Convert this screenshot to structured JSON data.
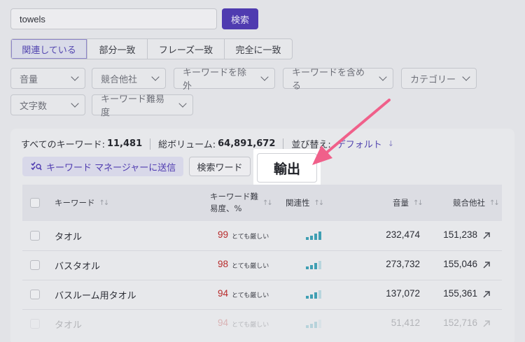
{
  "search": {
    "value": "towels",
    "button_label": "検索"
  },
  "match_tabs": [
    {
      "label": "関連している",
      "active": true
    },
    {
      "label": "部分一致",
      "active": false
    },
    {
      "label": "フレーズ一致",
      "active": false
    },
    {
      "label": "完全に一致",
      "active": false
    }
  ],
  "filters": [
    "音量",
    "競合他社",
    "キーワードを除外",
    "キーワードを含める",
    "カテゴリー",
    "文字数",
    "キーワード難易度"
  ],
  "summary": {
    "all_keywords_label": "すべてのキーワード:",
    "all_keywords_value": "11,481",
    "total_volume_label": "総ボリューム:",
    "total_volume_value": "64,891,672",
    "sort_label": "並び替え:",
    "sort_value": "デフォルト"
  },
  "actions": {
    "send_to_manager": "キーワード マネージャーに送信",
    "search_words": "検索ワード",
    "export": "輸出"
  },
  "table": {
    "headers": {
      "keyword": "キーワード",
      "difficulty_line1": "キーワード難",
      "difficulty_line2": "易度、%",
      "relevance": "関連性",
      "volume": "音量",
      "competitors": "競合他社"
    },
    "rows": [
      {
        "keyword": "タオル",
        "difficulty": "99",
        "difficulty_label": "とても厳しい",
        "relevance": 4,
        "volume": "232,474",
        "competitors": "151,238"
      },
      {
        "keyword": "バスタオル",
        "difficulty": "98",
        "difficulty_label": "とても厳しい",
        "relevance": 3,
        "volume": "273,732",
        "competitors": "155,046"
      },
      {
        "keyword": "バスルーム用タオル",
        "difficulty": "94",
        "difficulty_label": "とても厳しい",
        "relevance": 3,
        "volume": "137,072",
        "competitors": "155,361"
      },
      {
        "keyword": "タオル",
        "difficulty": "94",
        "difficulty_label": "とても厳しい",
        "relevance": 3,
        "volume": "51,412",
        "competitors": "152,716"
      }
    ]
  },
  "colors": {
    "accent": "#4f3bb0",
    "difficulty_red": "#b72a2a",
    "relevance_bar": "#3f9fb3",
    "annotation_arrow": "#f0608a"
  }
}
